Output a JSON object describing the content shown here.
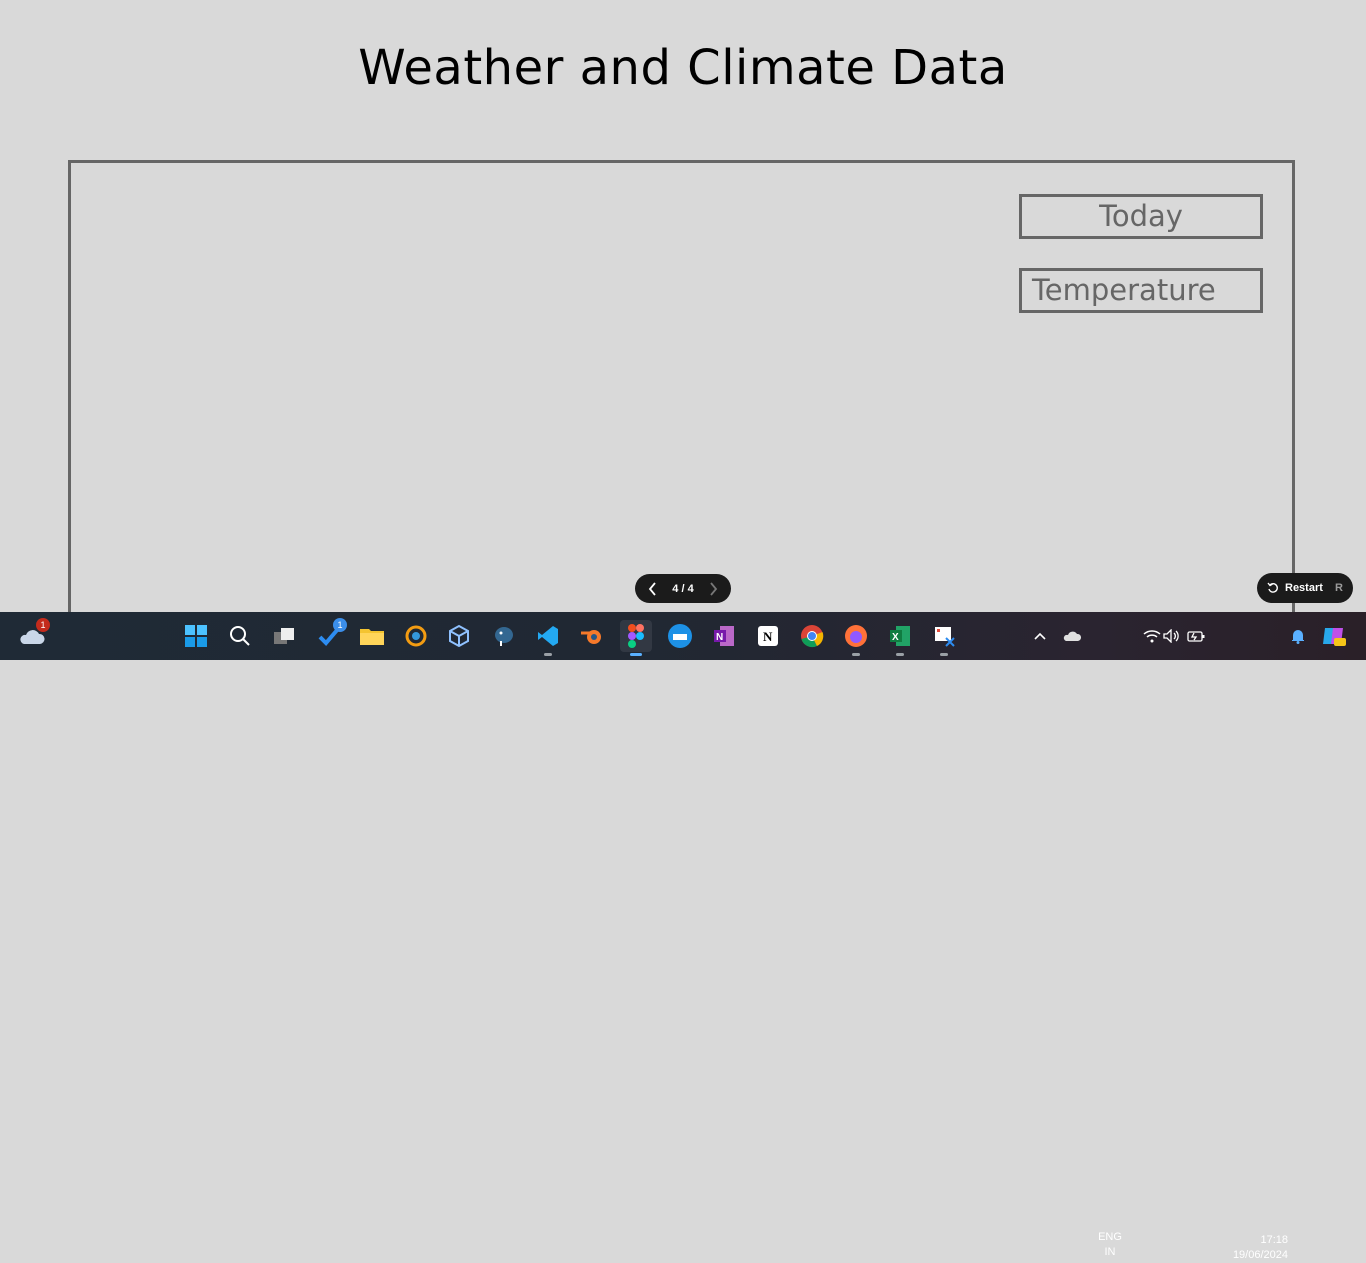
{
  "slide": {
    "title": "Weather and Climate Data",
    "chips": {
      "today": "Today",
      "temperature": "Temperature"
    }
  },
  "presentation_controls": {
    "page_indicator": "4 / 4",
    "restart_label": "Restart",
    "restart_shortcut": "R"
  },
  "taskbar": {
    "weather_badge": "1",
    "pinned_badge": "1",
    "apps": [
      "start-icon",
      "search-icon",
      "task-view-icon",
      "tasks-app-icon",
      "file-explorer-icon",
      "app-icon",
      "virtualbox-icon",
      "postgres-icon",
      "vscode-icon",
      "blender-icon",
      "figma-icon",
      "docker-icon",
      "onenote-icon",
      "notion-icon",
      "chrome-icon",
      "firefox-icon",
      "excel-icon",
      "snipping-tool-icon"
    ],
    "tray": {
      "language": "ENG",
      "region": "IN",
      "time": "17:18",
      "date": "19/06/2024"
    }
  },
  "colors": {
    "background": "#d9d9d9",
    "frame": "#666666",
    "pill": "#1b1b1b"
  }
}
